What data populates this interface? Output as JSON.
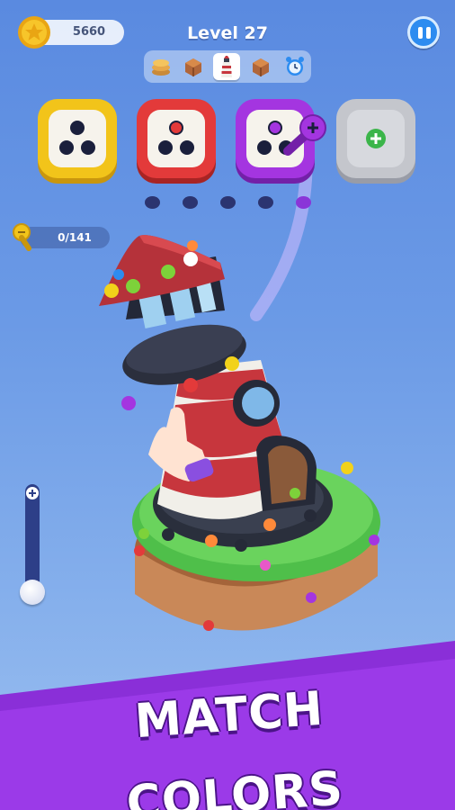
{
  "hud": {
    "coins": "5660",
    "level_label": "Level 27",
    "screw_counter": "0/141"
  },
  "goals": [
    {
      "name": "pancake-stack-icon",
      "active": false
    },
    {
      "name": "crate-icon",
      "active": false
    },
    {
      "name": "lighthouse-icon",
      "active": true
    },
    {
      "name": "crate-icon",
      "active": false
    },
    {
      "name": "alarm-clock-icon",
      "active": false
    }
  ],
  "screw_boxes": [
    {
      "color": "yellow",
      "hex": "#f2c41a",
      "holes": 3,
      "filled": 0
    },
    {
      "color": "red",
      "hex": "#e33a3a",
      "holes": 3,
      "filled": 1
    },
    {
      "color": "purple",
      "hex": "#a435e0",
      "holes": 3,
      "filled": 1
    },
    {
      "color": "locked",
      "hex": "#c4c6cc",
      "holes": 0,
      "filled": 0
    }
  ],
  "banner": {
    "text": "MATCH COLORS",
    "color": "#8a2fd8"
  },
  "colors": {
    "background": "#6b9ae6",
    "pause_button": "#2d8cf0"
  }
}
